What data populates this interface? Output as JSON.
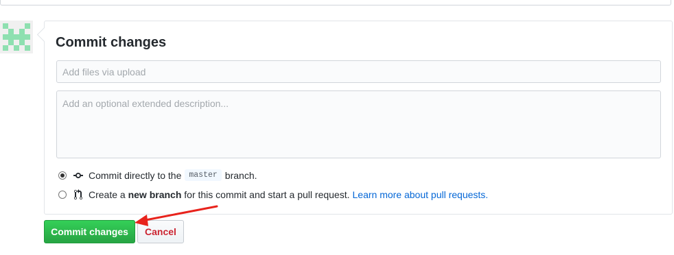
{
  "commit_form": {
    "title": "Commit changes",
    "summary_placeholder": "Add files via upload",
    "summary_value": "",
    "description_placeholder": "Add an optional extended description...",
    "description_value": "",
    "options": {
      "direct": {
        "selected": true,
        "text_before": "Commit directly to the",
        "branch_name": "master",
        "text_after": "branch."
      },
      "new_branch": {
        "selected": false,
        "text_before": "Create a",
        "bold_text": "new branch",
        "text_after": "for this commit and start a pull request.",
        "link_text": "Learn more about pull requests."
      }
    }
  },
  "buttons": {
    "commit_label": "Commit changes",
    "cancel_label": "Cancel"
  },
  "icons": {
    "avatar": "identicon-avatar",
    "commit": "git-commit-icon",
    "pull_request": "git-pull-request-icon"
  },
  "colors": {
    "primary_button": "#28a745",
    "cancel_text": "#cb2431",
    "link": "#0366d6",
    "identicon": "#8ee0b0",
    "annotation_arrow": "#e8231c"
  }
}
